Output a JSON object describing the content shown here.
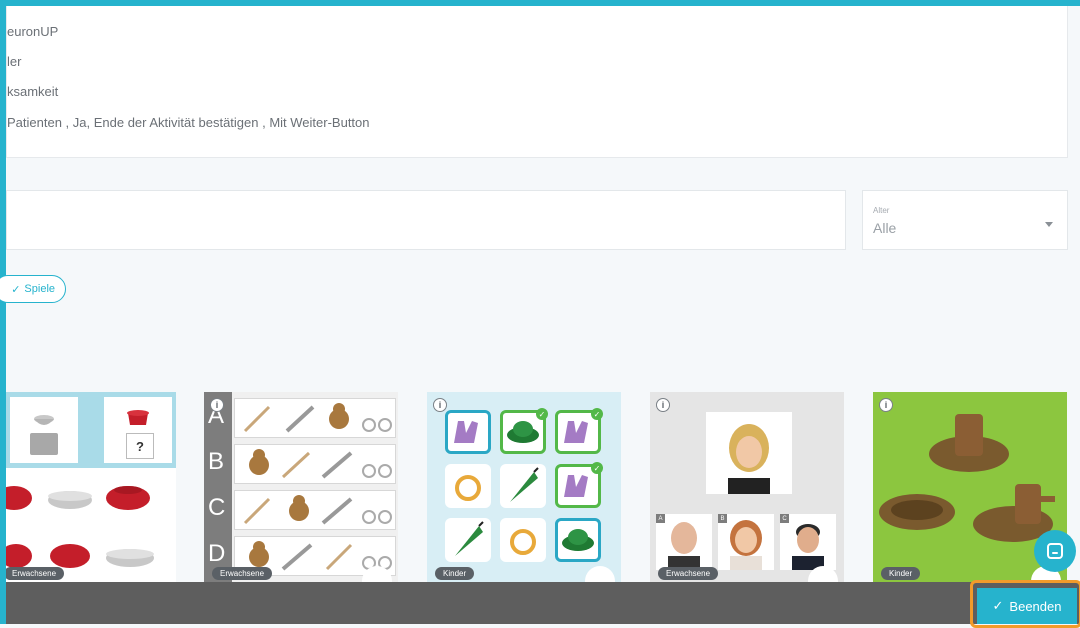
{
  "info": {
    "line1": "euronUP",
    "line2": "ler",
    "line3": "ksamkeit",
    "line4": "Patienten , Ja, Ende der Aktivität bestätigen , Mit Weiter-Button"
  },
  "filters": {
    "search_value": "",
    "age_label": "Alter",
    "age_value": "Alle",
    "chip_label": "Spiele"
  },
  "cards": [
    {
      "tag": "Erwachsene"
    },
    {
      "tag": "Erwachsene",
      "letters": [
        "A",
        "B",
        "C",
        "D"
      ]
    },
    {
      "tag": "Kinder"
    },
    {
      "tag": "Erwachsene",
      "photo_labels": [
        "A",
        "B",
        "C"
      ]
    },
    {
      "tag": "Kinder"
    }
  ],
  "card1": {
    "question_mark": "?"
  },
  "footer": {
    "finish_label": "Beenden"
  },
  "colors": {
    "accent": "#26b3cd",
    "highlight": "#f29b2a",
    "footer": "#5e5e5e"
  },
  "icons": {
    "check": "check-icon",
    "info": "info-icon",
    "chat": "chat-icon",
    "caret": "chevron-down-icon"
  }
}
